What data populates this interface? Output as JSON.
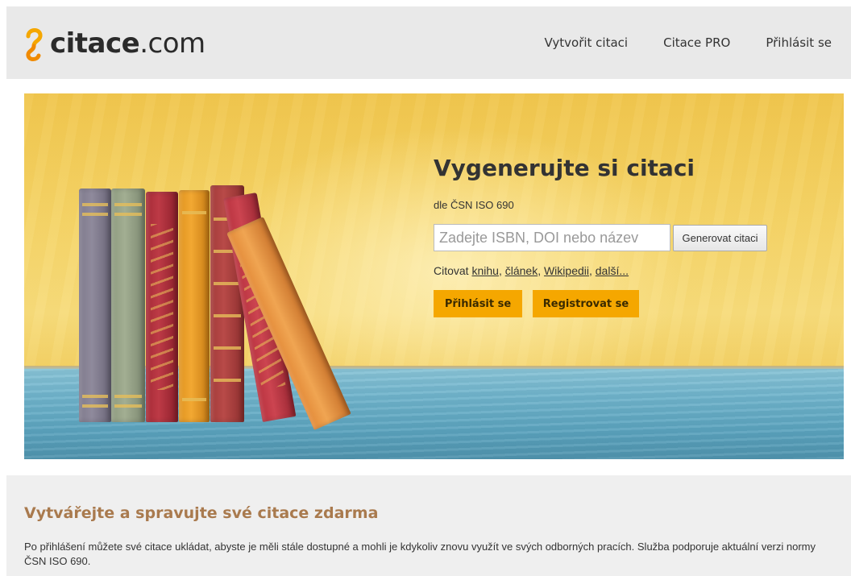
{
  "header": {
    "logo_word": "citace",
    "logo_domain": ".com",
    "nav": [
      "Vytvořit citaci",
      "Citace PRO",
      "Přihlásit se"
    ]
  },
  "hero": {
    "title": "Vygenerujte si citaci",
    "subtitle": "dle ČSN ISO 690",
    "search_placeholder": "Zadejte ISBN, DOI nebo název",
    "search_value": "",
    "generate_label": "Generovat citaci",
    "cite_prefix": "Citovat",
    "cite_links": [
      "knihu",
      "článek",
      "Wikipedii",
      "další..."
    ],
    "login_label": "Přihlásit se",
    "register_label": "Registrovat se"
  },
  "section": {
    "title": "Vytvářejte a spravujte své citace zdarma",
    "text": "Po přihlášení můžete své citace ukládat, abyste je měli stále dostupné a mohli je kdykoliv znovu využít ve svých odborných pracích. Služba podporuje aktuální verzi normy ČSN ISO 690."
  },
  "colors": {
    "accent_orange": "#f5a700",
    "section_title": "#a97a4e",
    "header_bg": "#e9e9e9"
  }
}
